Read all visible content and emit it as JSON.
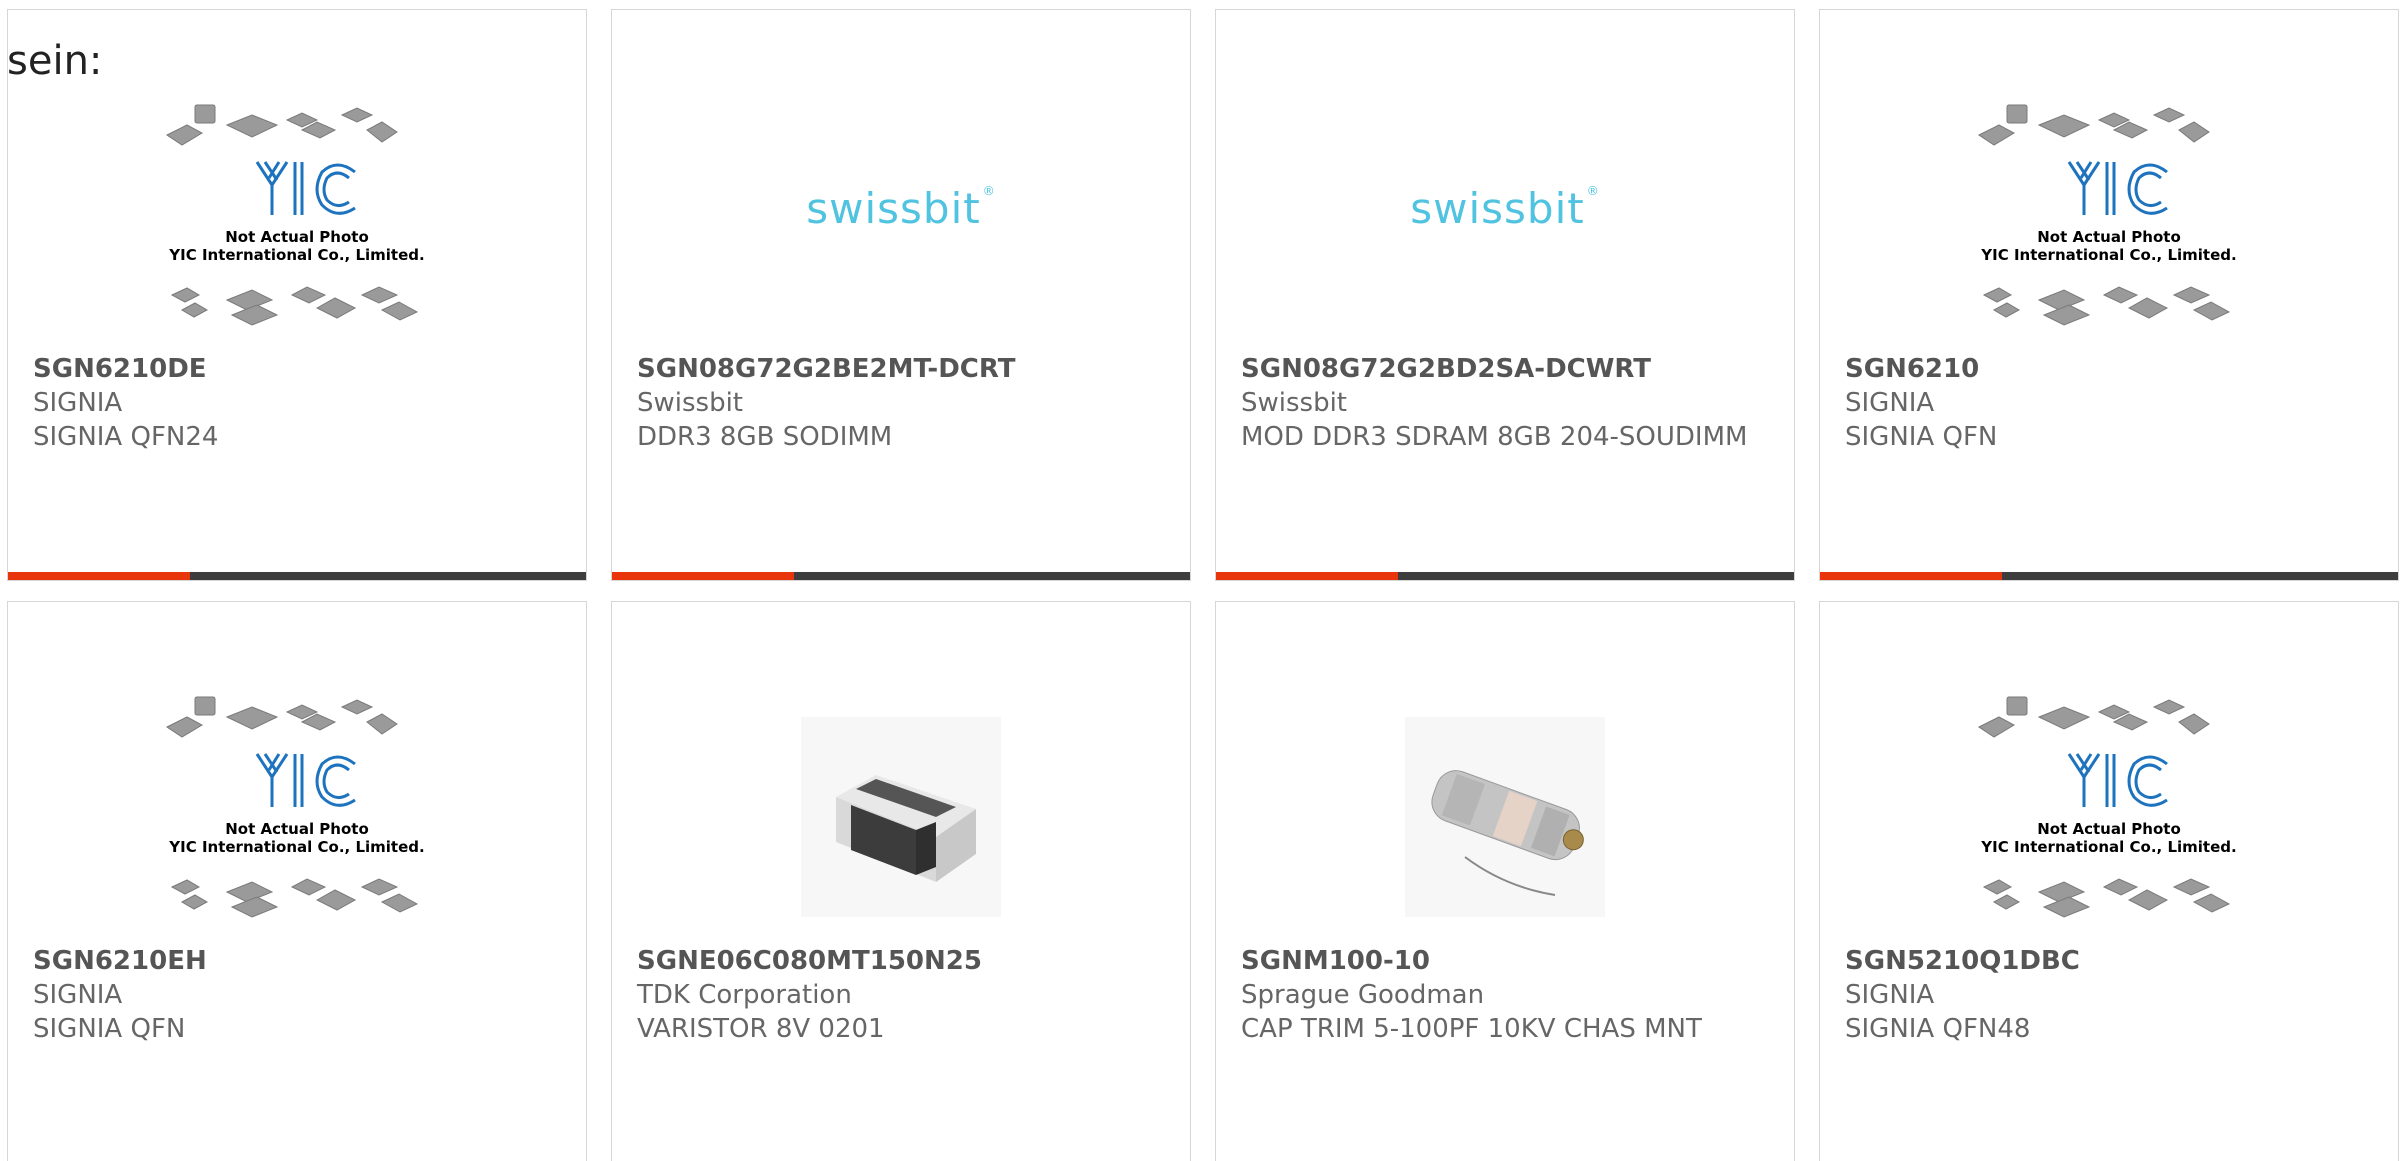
{
  "intro_text": "sein:",
  "placeholder_photo": {
    "logo_text": "YIC",
    "caption_line1": "Not Actual Photo",
    "caption_line2": "YIC International Co., Limited."
  },
  "brand_logo_text": "swissbit",
  "brand_logo_mark": "®",
  "colors": {
    "accent_bar": "#e8350c",
    "bar": "#3d3d3d",
    "swissbit_blue": "#4fc3e0",
    "yic_blue": "#1e73be"
  },
  "products": [
    {
      "part_number": "SGN6210DE",
      "manufacturer": "SIGNIA",
      "description": "SIGNIA QFN24",
      "image": "yic-placeholder"
    },
    {
      "part_number": "SGN08G72G2BE2MT-DCRT",
      "manufacturer": "Swissbit",
      "description": "DDR3 8GB SODIMM",
      "image": "swissbit-logo"
    },
    {
      "part_number": "SGN08G72G2BD2SA-DCWRT",
      "manufacturer": "Swissbit",
      "description": "MOD DDR3 SDRAM 8GB 204-SOUDIMM",
      "image": "swissbit-logo"
    },
    {
      "part_number": "SGN6210",
      "manufacturer": "SIGNIA",
      "description": "SIGNIA QFN",
      "image": "yic-placeholder"
    },
    {
      "part_number": "SGN6210EH",
      "manufacturer": "SIGNIA",
      "description": "SIGNIA QFN",
      "image": "yic-placeholder"
    },
    {
      "part_number": "SGNE06C080MT150N25",
      "manufacturer": "TDK Corporation",
      "description": "VARISTOR 8V 0201",
      "image": "chip-component"
    },
    {
      "part_number": "SGNM100-10",
      "manufacturer": "Sprague Goodman",
      "description": "CAP TRIM 5-100PF 10KV CHAS MNT",
      "image": "trimmer-capacitor"
    },
    {
      "part_number": "SGN5210Q1DBC",
      "manufacturer": "SIGNIA",
      "description": "SIGNIA QFN48",
      "image": "yic-placeholder"
    }
  ]
}
